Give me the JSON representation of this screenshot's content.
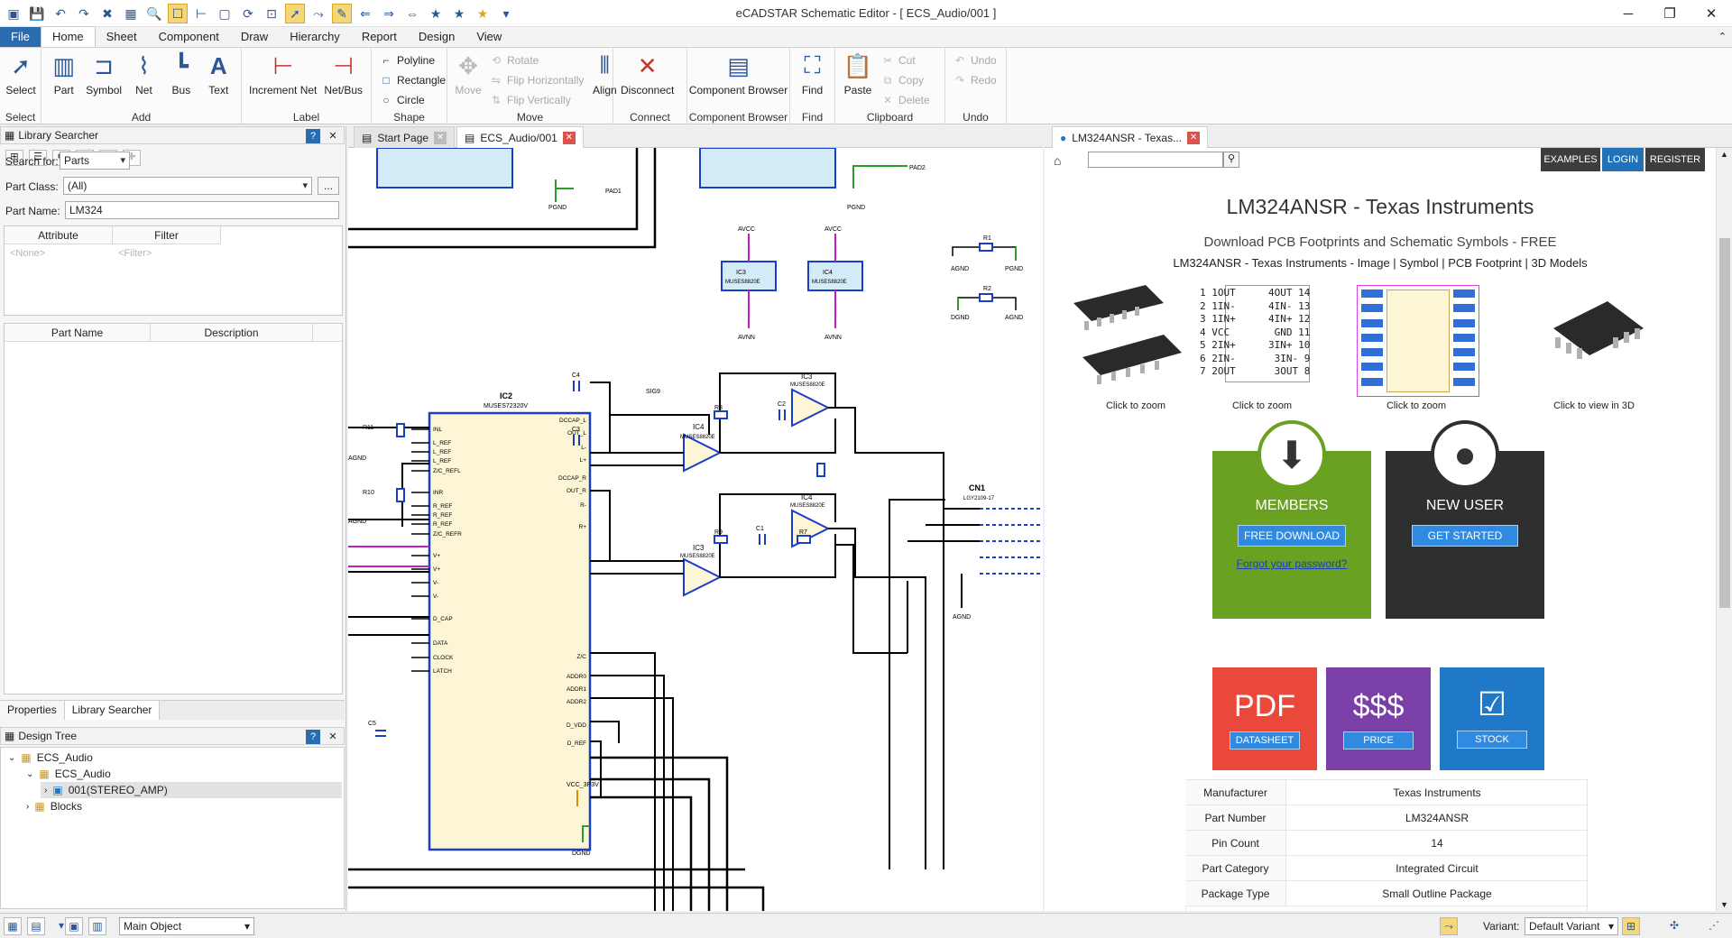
{
  "app": {
    "title": "eCADSTAR Schematic Editor - [ ECS_Audio/001 ]",
    "minimize": "─",
    "maximize": "❐",
    "close": "✕"
  },
  "menu": {
    "file": "File",
    "tabs": [
      "Home",
      "Sheet",
      "Component",
      "Draw",
      "Hierarchy",
      "Report",
      "Design",
      "View"
    ]
  },
  "ribbon": {
    "select": {
      "label": "Select",
      "group": "Select"
    },
    "add": {
      "part": "Part",
      "symbol": "Symbol",
      "net": "Net",
      "bus": "Bus",
      "text": "Text",
      "group": "Add"
    },
    "label": {
      "increment_net": "Increment Net",
      "net_bus": "Net/Bus",
      "group": "Label"
    },
    "shape": {
      "polyline": "Polyline",
      "rectangle": "Rectangle",
      "circle": "Circle",
      "group": "Shape"
    },
    "move": {
      "move": "Move",
      "rotate": "Rotate",
      "flip_h": "Flip Horizontally",
      "flip_v": "Flip Vertically",
      "align": "Align",
      "group": "Move"
    },
    "connect": {
      "disconnect": "Disconnect",
      "group": "Connect"
    },
    "browser": {
      "component_browser": "Component Browser",
      "group": "Component Browser"
    },
    "find": {
      "find": "Find",
      "group": "Find"
    },
    "clipboard": {
      "paste": "Paste",
      "cut": "Cut",
      "copy": "Copy",
      "delete": "Delete",
      "group": "Clipboard"
    },
    "undo": {
      "undo": "Undo",
      "redo": "Redo",
      "group": "Undo"
    }
  },
  "library_searcher": {
    "title": "Library Searcher",
    "search_for_label": "Search for:",
    "search_for_value": "Parts",
    "part_class_label": "Part Class:",
    "part_class_value": "(All)",
    "more_btn": "...",
    "part_name_label": "Part Name:",
    "part_name_value": "LM324",
    "attr_headers": [
      "Attribute",
      "Filter"
    ],
    "attr_placeholders": [
      "<None>",
      "<Filter>"
    ],
    "result_headers": [
      "Part Name",
      "Description"
    ]
  },
  "left_tabs": [
    "Properties",
    "Library Searcher"
  ],
  "design_tree": {
    "title": "Design Tree",
    "items": [
      "ECS_Audio",
      "ECS_Audio",
      "001(STEREO_AMP)",
      "Blocks"
    ]
  },
  "doc_tabs": [
    {
      "label": "Start Page"
    },
    {
      "label": "ECS_Audio/001"
    }
  ],
  "schematic": {
    "labels": {
      "pad1": "PAD1",
      "pad2": "PAD2",
      "pgnd": "PGND",
      "agnd": "AGND",
      "dgnd": "DGND",
      "avcc": "AVCC",
      "avnn": "AVNN",
      "ic2": "IC2",
      "ic2_part": "MUSES72320V",
      "ic3": "IC3",
      "ic4": "IC4",
      "ic_part": "MUSES8820E",
      "cn1": "CN1",
      "cn1_part": "LGY2109-17",
      "vcc": "VCC_3P3V",
      "sig9": "SIG9",
      "r1": "R1",
      "r2": "R2",
      "r8": "R8",
      "r9": "R9",
      "r7": "R7",
      "r10": "R10",
      "r11": "R11",
      "c1": "C1",
      "c2": "C2",
      "c3": "C3",
      "c4": "C4",
      "c5": "C5",
      "pins_left": [
        "INL",
        "L_REF",
        "L_REF",
        "L_REF",
        "Z/C_REFL",
        "INR",
        "R_REF",
        "R_REF",
        "R_REF",
        "Z/C_REFR",
        "V+",
        "V+",
        "V-",
        "V-",
        "D_CAP",
        "DATA",
        "CLOCK",
        "LATCH"
      ],
      "pins_right": [
        "DCCAP_L",
        "OUT_L",
        "L-",
        "L+",
        "DCCAP_R",
        "OUT_R",
        "R-",
        "R+",
        "Z/C",
        "ADDR0",
        "ADDR1",
        "ADDR2",
        "D_VDD",
        "D_REF"
      ]
    }
  },
  "web_tab": {
    "label": "LM324ANSR - Texas..."
  },
  "web": {
    "nav": [
      "EXAMPLES",
      "LOGIN",
      "REGISTER"
    ],
    "title": "LM324ANSR - Texas Instruments",
    "subtitle": "Download PCB Footprints and Schematic Symbols - FREE",
    "links": "LM324ANSR - Texas Instruments - Image | Symbol | PCB Footprint | 3D Models",
    "zoom1": "Click to zoom",
    "zoom2": "Click to zoom",
    "view3d": "Click to view in 3D",
    "symbol_left": [
      "1OUT",
      "1IN-",
      "1IN+",
      "VCC",
      "2IN+",
      "2IN-",
      "2OUT"
    ],
    "symbol_right": [
      "4OUT",
      "4IN-",
      "4IN+",
      "GND",
      "3IN+",
      "3IN-",
      "3OUT"
    ],
    "pin_left_nums": [
      "1",
      "2",
      "3",
      "4",
      "5",
      "6",
      "7"
    ],
    "pin_right_nums": [
      "14",
      "13",
      "12",
      "11",
      "10",
      "9",
      "8"
    ],
    "members": {
      "title": "MEMBERS",
      "button": "FREE DOWNLOAD",
      "link": "Forgot your password?"
    },
    "new_user": {
      "title": "NEW USER",
      "button": "GET STARTED"
    },
    "pdf": {
      "title": "PDF",
      "button": "DATASHEET"
    },
    "price": {
      "title": "$$$",
      "button": "PRICE"
    },
    "stock": {
      "title": "☑",
      "button": "STOCK"
    },
    "specs": [
      {
        "k": "Manufacturer",
        "v": "Texas Instruments"
      },
      {
        "k": "Part Number",
        "v": "LM324ANSR"
      },
      {
        "k": "Pin Count",
        "v": "14"
      },
      {
        "k": "Part Category",
        "v": "Integrated Circuit"
      },
      {
        "k": "Package Type",
        "v": "Small Outline Package"
      }
    ],
    "colors": {
      "members": "#6aa121",
      "new_user": "#2f2f2f",
      "pdf": "#e9483b",
      "price": "#7b3fa8",
      "stock": "#1f78c8",
      "login": "#2371b7",
      "nav_dark": "#3d3d3d"
    }
  },
  "statusbar": {
    "main_object": "Main Object",
    "variant_label": "Variant:",
    "variant_value": "Default Variant"
  }
}
